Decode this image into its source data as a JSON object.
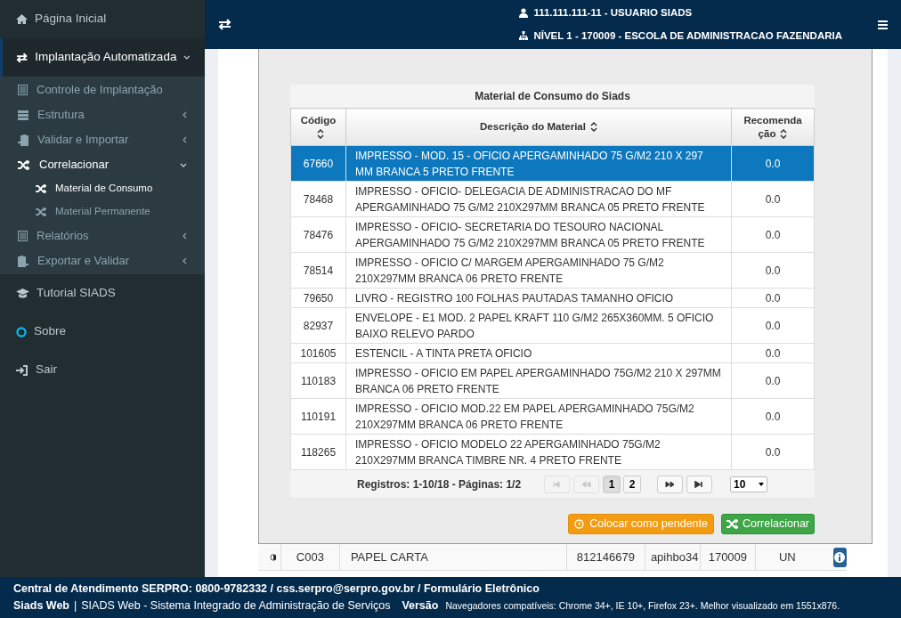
{
  "sidebar": {
    "items": [
      {
        "label": "Página Inicial",
        "selected": false
      },
      {
        "label": "Implantação Automatizada",
        "selected": true,
        "expanded": true,
        "children": [
          {
            "label": "Controle de Implantação",
            "selected": false
          },
          {
            "label": "Estrutura",
            "selected": false,
            "expanded": false
          },
          {
            "label": "Validar e Importar",
            "selected": false,
            "expanded": false
          },
          {
            "label": "Correlacionar",
            "selected": false,
            "expanded": true,
            "children": [
              {
                "label": "Material de Consumo",
                "selected": true
              },
              {
                "label": "Material Permanente",
                "selected": false
              }
            ]
          },
          {
            "label": "Relatórios",
            "selected": false,
            "expanded": false
          },
          {
            "label": "Exportar e Validar",
            "selected": false,
            "expanded": false
          }
        ]
      },
      {
        "label": "Tutorial SIADS",
        "selected": false
      },
      {
        "label": "Sobre",
        "selected": false
      },
      {
        "label": "Sair",
        "selected": false
      }
    ]
  },
  "header": {
    "user": "111.111.111-11 - USUARIO SIADS",
    "unit": "NÍVEL 1 - 170009 - ESCOLA DE ADMINISTRACAO FAZENDARIA"
  },
  "table": {
    "title": "Material de Consumo do Siads",
    "columns": [
      "Código",
      "Descrição do Material",
      "Recomenda ção"
    ],
    "rows": [
      {
        "code": "67660",
        "description": "IMPRESSO - MOD. 15 - OFICIO APERGAMINHADO 75 G/M2 210 X 297 MM BRANCA 5 PRETO FRENTE",
        "recommendation": "0.0",
        "selected": true
      },
      {
        "code": "78468",
        "description": "IMPRESSO - OFICIO- DELEGACIA DE ADMINISTRACAO DO MF APERGAMINHADO 75 G/M2 210X297MM BRANCA 05 PRETO FRENTE",
        "recommendation": "0.0",
        "selected": false
      },
      {
        "code": "78476",
        "description": "IMPRESSO - OFICIO- SECRETARIA DO TESOURO NACIONAL APERGAMINHADO 75 G/M2 210X297MM BRANCA 05 PRETO FRENTE",
        "recommendation": "0.0",
        "selected": false
      },
      {
        "code": "78514",
        "description": "IMPRESSO - OFICIO C/ MARGEM APERGAMINHADO 75 G/M2 210X297MM BRANCA 06 PRETO FRENTE",
        "recommendation": "0.0",
        "selected": false
      },
      {
        "code": "79650",
        "description": "LIVRO - REGISTRO 100 FOLHAS PAUTADAS TAMANHO OFICIO",
        "recommendation": "0.0",
        "selected": false
      },
      {
        "code": "82937",
        "description": "ENVELOPE - E1 MOD. 2 PAPEL KRAFT 110 G/M2 265X360MM. 5 OFICIO BAIXO RELEVO PARDO",
        "recommendation": "0.0",
        "selected": false
      },
      {
        "code": "101605",
        "description": "ESTENCIL - A TINTA PRETA OFICIO",
        "recommendation": "0.0",
        "selected": false
      },
      {
        "code": "110183",
        "description": "IMPRESSO - OFICIO EM PAPEL APERGAMINHADO 75G/M2 210 X 297MM BRANCA 06 PRETO FRENTE",
        "recommendation": "0.0",
        "selected": false
      },
      {
        "code": "110191",
        "description": "IMPRESSO - OFICIO MOD.22 EM PAPEL APERGAMINHADO 75G/M2 210X297MM BRANCA 06 PRETO FRENTE",
        "recommendation": "0.0",
        "selected": false
      },
      {
        "code": "118265",
        "description": "IMPRESSO - OFICIO MODELO 22 APERGAMINHADO 75G/M2 210X297MM BRANCA TIMBRE NR. 4 PRETO FRENTE",
        "recommendation": "0.0",
        "selected": false
      }
    ],
    "records": "Registros: 1-10/18 - Páginas: 1/2",
    "pager": [
      {
        "kind": "first",
        "disabled": true
      },
      {
        "kind": "prev",
        "disabled": true
      },
      {
        "kind": "page",
        "label": "1",
        "selected": true
      },
      {
        "kind": "page",
        "label": "2",
        "selected": false
      },
      {
        "kind": "next",
        "disabled": false
      },
      {
        "kind": "last",
        "disabled": false
      }
    ],
    "page_size": "10"
  },
  "buttons": [
    {
      "kind": "pending",
      "label": "Colocar como pendente"
    },
    {
      "kind": "correlate",
      "label": "Correlacionar"
    }
  ],
  "background_row": [
    "C003",
    "PAPEL CARTA",
    "812146679",
    "apihbo34",
    "170009",
    "UN"
  ],
  "footer": {
    "contact": "Central de Atendimento SERPRO: 0800-9782332 / css.serpro@serpro.gov.br / Formulário Eletrônico",
    "app": "Siads Web",
    "separator": "|",
    "system": "SIADS Web - Sistema Integrado de Administração de Serviços",
    "version_label": "Versão",
    "browsers": "Navegadores compatíveis: Chrome 34+, IE 10+, Firefox 23+. Melhor visualizado em 1551x876."
  }
}
